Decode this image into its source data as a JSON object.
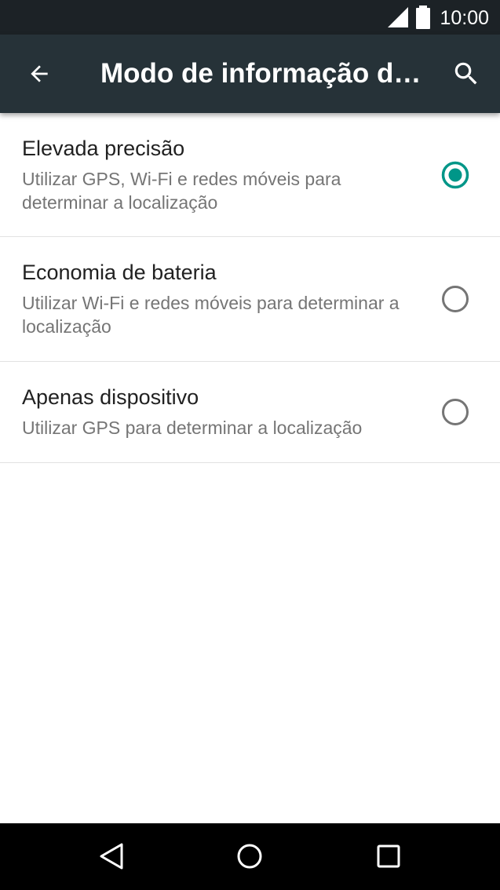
{
  "status_bar": {
    "time": "10:00",
    "signal_icon": "cell-signal-icon",
    "battery_icon": "battery-full-icon",
    "background": "#1c2226"
  },
  "toolbar": {
    "title": "Modo de informação da localização",
    "back_icon": "arrow-back-icon",
    "search_icon": "search-icon",
    "background": "#263238"
  },
  "options": [
    {
      "title": "Elevada precisão",
      "description": "Utilizar GPS, Wi-Fi e redes móveis para determinar a localização",
      "selected": true
    },
    {
      "title": "Economia de bateria",
      "description": "Utilizar Wi-Fi e redes móveis para determinar a localização",
      "selected": false
    },
    {
      "title": "Apenas dispositivo",
      "description": "Utilizar GPS para determinar a localização",
      "selected": false
    }
  ],
  "nav_bar": {
    "back_icon": "nav-back-icon",
    "home_icon": "nav-home-icon",
    "recents_icon": "nav-recents-icon"
  },
  "colors": {
    "accent": "#009688",
    "radio_off": "#757575"
  }
}
